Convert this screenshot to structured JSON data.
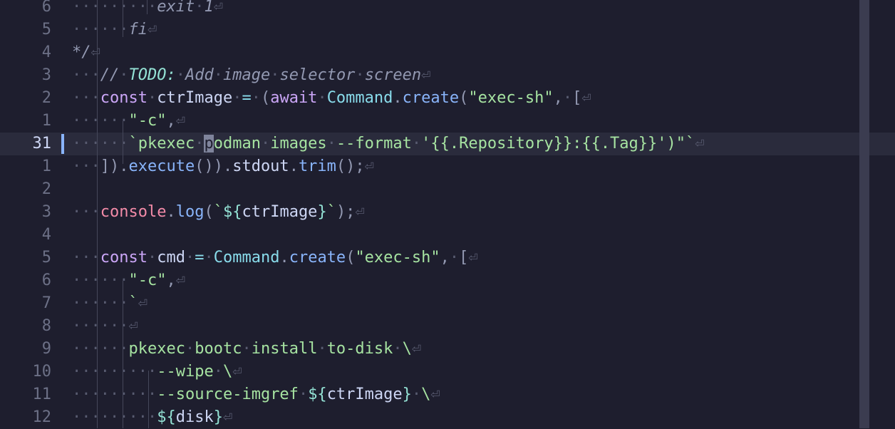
{
  "editor": {
    "current_line": "31",
    "lines": [
      {
        "num": "6",
        "tokens": [
          {
            "c": "ws",
            "t": "···"
          },
          {
            "c": "ws",
            "t": "···"
          },
          {
            "c": "ws",
            "t": "···"
          },
          {
            "c": "cmt",
            "t": "exit"
          },
          {
            "c": "ws",
            "t": "·"
          },
          {
            "c": "cmt",
            "t": "1"
          },
          {
            "c": "nl",
            "t": "⏎"
          }
        ]
      },
      {
        "num": "5",
        "tokens": [
          {
            "c": "ws",
            "t": "···"
          },
          {
            "c": "ws",
            "t": "···"
          },
          {
            "c": "cmt",
            "t": "fi"
          },
          {
            "c": "nl",
            "t": "⏎"
          }
        ]
      },
      {
        "num": "4",
        "tokens": [
          {
            "c": "cmt",
            "t": "*/"
          },
          {
            "c": "nl",
            "t": "⏎"
          }
        ]
      },
      {
        "num": "3",
        "tokens": [
          {
            "c": "ws",
            "t": "···"
          },
          {
            "c": "cmt",
            "t": "//"
          },
          {
            "c": "ws",
            "t": "·"
          },
          {
            "c": "todo",
            "t": "TODO:"
          },
          {
            "c": "ws",
            "t": "·"
          },
          {
            "c": "cmt",
            "t": "Add"
          },
          {
            "c": "ws",
            "t": "·"
          },
          {
            "c": "cmt",
            "t": "image"
          },
          {
            "c": "ws",
            "t": "·"
          },
          {
            "c": "cmt",
            "t": "selector"
          },
          {
            "c": "ws",
            "t": "·"
          },
          {
            "c": "cmt",
            "t": "screen"
          },
          {
            "c": "nl",
            "t": "⏎"
          }
        ]
      },
      {
        "num": "2",
        "tokens": [
          {
            "c": "ws",
            "t": "···"
          },
          {
            "c": "kw",
            "t": "const"
          },
          {
            "c": "ws",
            "t": "·"
          },
          {
            "c": "var",
            "t": "ctrImage"
          },
          {
            "c": "ws",
            "t": "·"
          },
          {
            "c": "op",
            "t": "="
          },
          {
            "c": "ws",
            "t": "·"
          },
          {
            "c": "pn",
            "t": "("
          },
          {
            "c": "kw",
            "t": "await"
          },
          {
            "c": "ws",
            "t": "·"
          },
          {
            "c": "ty",
            "t": "Command"
          },
          {
            "c": "pn",
            "t": "."
          },
          {
            "c": "fn",
            "t": "create"
          },
          {
            "c": "pn",
            "t": "("
          },
          {
            "c": "str",
            "t": "\"exec-sh\""
          },
          {
            "c": "pn",
            "t": ","
          },
          {
            "c": "ws",
            "t": "·"
          },
          {
            "c": "pn",
            "t": "["
          },
          {
            "c": "nl",
            "t": "⏎"
          }
        ]
      },
      {
        "num": "1",
        "tokens": [
          {
            "c": "ws",
            "t": "···"
          },
          {
            "c": "ws",
            "t": "···"
          },
          {
            "c": "str",
            "t": "\"-c\""
          },
          {
            "c": "pn",
            "t": ","
          },
          {
            "c": "nl",
            "t": "⏎"
          }
        ]
      },
      {
        "num": "31",
        "current": true,
        "tokens": [
          {
            "c": "ws",
            "t": "···"
          },
          {
            "c": "ws",
            "t": "···"
          },
          {
            "c": "str",
            "t": "`pkexec"
          },
          {
            "c": "ws",
            "t": "·"
          },
          {
            "c": "cursor",
            "t": "p"
          },
          {
            "c": "str",
            "t": "odman"
          },
          {
            "c": "ws",
            "t": "·"
          },
          {
            "c": "str",
            "t": "images"
          },
          {
            "c": "ws",
            "t": "·"
          },
          {
            "c": "str",
            "t": "--format"
          },
          {
            "c": "ws",
            "t": "·"
          },
          {
            "c": "str",
            "t": "'{{.Repository}}:{{.Tag}}')\"`"
          },
          {
            "c": "nl",
            "t": "⏎"
          }
        ]
      },
      {
        "num": "1",
        "tokens": [
          {
            "c": "ws",
            "t": "···"
          },
          {
            "c": "pn",
            "t": "])."
          },
          {
            "c": "fn",
            "t": "execute"
          },
          {
            "c": "pn",
            "t": "())."
          },
          {
            "c": "var",
            "t": "stdout"
          },
          {
            "c": "pn",
            "t": "."
          },
          {
            "c": "fn",
            "t": "trim"
          },
          {
            "c": "pn",
            "t": "();"
          },
          {
            "c": "nl",
            "t": "⏎"
          }
        ]
      },
      {
        "num": "2",
        "tokens": []
      },
      {
        "num": "3",
        "tokens": [
          {
            "c": "ws",
            "t": "···"
          },
          {
            "c": "con",
            "t": "console"
          },
          {
            "c": "pn",
            "t": "."
          },
          {
            "c": "fn",
            "t": "log"
          },
          {
            "c": "pn",
            "t": "("
          },
          {
            "c": "str",
            "t": "`"
          },
          {
            "c": "tmpl",
            "t": "${"
          },
          {
            "c": "var",
            "t": "ctrImage"
          },
          {
            "c": "tmpl",
            "t": "}"
          },
          {
            "c": "str",
            "t": "`"
          },
          {
            "c": "pn",
            "t": ");"
          },
          {
            "c": "nl",
            "t": "⏎"
          }
        ]
      },
      {
        "num": "4",
        "tokens": []
      },
      {
        "num": "5",
        "tokens": [
          {
            "c": "ws",
            "t": "···"
          },
          {
            "c": "kw",
            "t": "const"
          },
          {
            "c": "ws",
            "t": "·"
          },
          {
            "c": "var",
            "t": "cmd"
          },
          {
            "c": "ws",
            "t": "·"
          },
          {
            "c": "op",
            "t": "="
          },
          {
            "c": "ws",
            "t": "·"
          },
          {
            "c": "ty",
            "t": "Command"
          },
          {
            "c": "pn",
            "t": "."
          },
          {
            "c": "fn",
            "t": "create"
          },
          {
            "c": "pn",
            "t": "("
          },
          {
            "c": "str",
            "t": "\"exec-sh\""
          },
          {
            "c": "pn",
            "t": ","
          },
          {
            "c": "ws",
            "t": "·"
          },
          {
            "c": "pn",
            "t": "["
          },
          {
            "c": "nl",
            "t": "⏎"
          }
        ]
      },
      {
        "num": "6",
        "tokens": [
          {
            "c": "ws",
            "t": "···"
          },
          {
            "c": "ws",
            "t": "···"
          },
          {
            "c": "str",
            "t": "\"-c\""
          },
          {
            "c": "pn",
            "t": ","
          },
          {
            "c": "nl",
            "t": "⏎"
          }
        ]
      },
      {
        "num": "7",
        "tokens": [
          {
            "c": "ws",
            "t": "···"
          },
          {
            "c": "ws",
            "t": "···"
          },
          {
            "c": "str",
            "t": "`"
          },
          {
            "c": "nl",
            "t": "⏎"
          }
        ]
      },
      {
        "num": "8",
        "tokens": [
          {
            "c": "ws",
            "t": "···"
          },
          {
            "c": "ws",
            "t": "···"
          },
          {
            "c": "nl",
            "t": "⏎"
          }
        ]
      },
      {
        "num": "9",
        "tokens": [
          {
            "c": "ws",
            "t": "···"
          },
          {
            "c": "ws",
            "t": "···"
          },
          {
            "c": "str",
            "t": "pkexec"
          },
          {
            "c": "ws",
            "t": "·"
          },
          {
            "c": "str",
            "t": "bootc"
          },
          {
            "c": "ws",
            "t": "·"
          },
          {
            "c": "str",
            "t": "install"
          },
          {
            "c": "ws",
            "t": "·"
          },
          {
            "c": "str",
            "t": "to-disk"
          },
          {
            "c": "ws",
            "t": "·"
          },
          {
            "c": "str",
            "t": "\\"
          },
          {
            "c": "nl",
            "t": "⏎"
          }
        ]
      },
      {
        "num": "10",
        "tokens": [
          {
            "c": "ws",
            "t": "···"
          },
          {
            "c": "ws",
            "t": "···"
          },
          {
            "c": "ws",
            "t": "···"
          },
          {
            "c": "str",
            "t": "--wipe"
          },
          {
            "c": "ws",
            "t": "·"
          },
          {
            "c": "str",
            "t": "\\"
          },
          {
            "c": "nl",
            "t": "⏎"
          }
        ]
      },
      {
        "num": "11",
        "tokens": [
          {
            "c": "ws",
            "t": "···"
          },
          {
            "c": "ws",
            "t": "···"
          },
          {
            "c": "ws",
            "t": "···"
          },
          {
            "c": "str",
            "t": "--source-imgref"
          },
          {
            "c": "ws",
            "t": "·"
          },
          {
            "c": "tmpl",
            "t": "${"
          },
          {
            "c": "var",
            "t": "ctrImage"
          },
          {
            "c": "tmpl",
            "t": "}"
          },
          {
            "c": "ws",
            "t": "·"
          },
          {
            "c": "str",
            "t": "\\"
          },
          {
            "c": "nl",
            "t": "⏎"
          }
        ]
      },
      {
        "num": "12",
        "tokens": [
          {
            "c": "ws",
            "t": "···"
          },
          {
            "c": "ws",
            "t": "···"
          },
          {
            "c": "ws",
            "t": "···"
          },
          {
            "c": "tmpl",
            "t": "${"
          },
          {
            "c": "var",
            "t": "disk"
          },
          {
            "c": "tmpl",
            "t": "}"
          },
          {
            "c": "nl",
            "t": "⏎"
          }
        ]
      }
    ]
  },
  "colors": {
    "background": "#1e1e2e",
    "current_line": "#2a2b3c",
    "keyword": "#cba6f7",
    "string": "#a6e3a1",
    "function": "#89b4fa",
    "comment": "#9399b2",
    "console": "#f38ba8"
  }
}
